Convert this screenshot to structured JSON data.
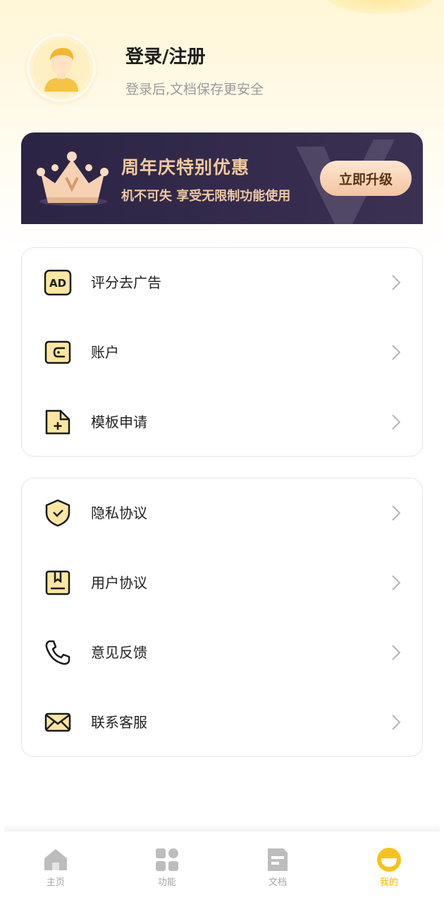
{
  "profile": {
    "title": "登录/注册",
    "subtitle": "登录后,文档保存更安全",
    "avatar_icon": "user-avatar-icon"
  },
  "promo": {
    "title": "周年庆特别优惠",
    "subtitle": "机不可失 享受无限制功能使用",
    "button_label": "立即升级",
    "crown_icon": "crown-icon"
  },
  "menu_group_1": [
    {
      "label": "评分去广告",
      "icon": "ad-icon"
    },
    {
      "label": "账户",
      "icon": "wallet-icon"
    },
    {
      "label": "模板申请",
      "icon": "file-add-icon"
    }
  ],
  "menu_group_2": [
    {
      "label": "隐私协议",
      "icon": "shield-check-icon"
    },
    {
      "label": "用户协议",
      "icon": "bookmark-doc-icon"
    },
    {
      "label": "意见反馈",
      "icon": "phone-icon"
    },
    {
      "label": "联系客服",
      "icon": "mail-icon"
    }
  ],
  "bottom_nav": {
    "tabs": [
      {
        "label": "主页",
        "icon": "home-icon"
      },
      {
        "label": "功能",
        "icon": "apps-icon"
      },
      {
        "label": "文档",
        "icon": "document-icon"
      },
      {
        "label": "我的",
        "icon": "profile-face-icon"
      }
    ],
    "active_index": 3
  },
  "colors": {
    "accent": "#f4b400",
    "icon_fill": "#fde7a0",
    "banner_bg": "#2b2444",
    "banner_text": "#f3c99d"
  }
}
